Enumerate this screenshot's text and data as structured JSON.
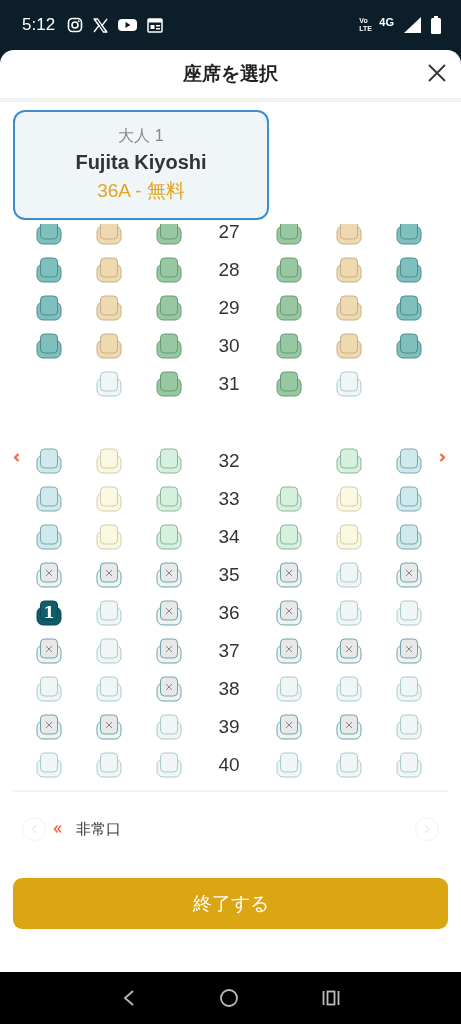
{
  "status_bar": {
    "time": "5:12",
    "volte": "Vo LTE",
    "network": "4G"
  },
  "header": {
    "title": "座席を選択"
  },
  "passengers": [
    {
      "label": "大人 1",
      "name": "Fujita Kiyoshi",
      "seat": "36A - 無料",
      "selected": true
    }
  ],
  "seat_rows": [
    {
      "label": "27",
      "exit": false,
      "seats": [
        {
          "kind": "teal"
        },
        {
          "kind": "tan"
        },
        {
          "kind": "green"
        },
        {
          "kind": "green"
        },
        {
          "kind": "tan"
        },
        {
          "kind": "teal"
        }
      ]
    },
    {
      "label": "28",
      "exit": false,
      "seats": [
        {
          "kind": "teal"
        },
        {
          "kind": "tan"
        },
        {
          "kind": "green"
        },
        {
          "kind": "green"
        },
        {
          "kind": "tan"
        },
        {
          "kind": "teal"
        }
      ]
    },
    {
      "label": "29",
      "exit": false,
      "seats": [
        {
          "kind": "teal"
        },
        {
          "kind": "tan"
        },
        {
          "kind": "green"
        },
        {
          "kind": "green"
        },
        {
          "kind": "tan"
        },
        {
          "kind": "teal"
        }
      ]
    },
    {
      "label": "30",
      "exit": false,
      "seats": [
        {
          "kind": "teal"
        },
        {
          "kind": "tan"
        },
        {
          "kind": "green"
        },
        {
          "kind": "green"
        },
        {
          "kind": "tan"
        },
        {
          "kind": "teal"
        }
      ]
    },
    {
      "label": "31",
      "exit": false,
      "seats": [
        {
          "kind": "none"
        },
        {
          "kind": "free"
        },
        {
          "kind": "green"
        },
        {
          "kind": "green"
        },
        {
          "kind": "free"
        },
        {
          "kind": "none"
        }
      ]
    },
    {
      "label": "32",
      "exit": true,
      "seats": [
        {
          "kind": "lightblue"
        },
        {
          "kind": "cream"
        },
        {
          "kind": "lightgreen"
        },
        {
          "kind": "none"
        },
        {
          "kind": "lightgreen"
        },
        {
          "kind": "lightblue"
        }
      ]
    },
    {
      "label": "33",
      "exit": false,
      "seats": [
        {
          "kind": "lightblue"
        },
        {
          "kind": "cream"
        },
        {
          "kind": "lightgreen"
        },
        {
          "kind": "lightgreen"
        },
        {
          "kind": "cream"
        },
        {
          "kind": "lightblue"
        }
      ]
    },
    {
      "label": "34",
      "exit": false,
      "seats": [
        {
          "kind": "lightblue"
        },
        {
          "kind": "cream"
        },
        {
          "kind": "lightgreen"
        },
        {
          "kind": "lightgreen"
        },
        {
          "kind": "cream"
        },
        {
          "kind": "lightblue"
        }
      ]
    },
    {
      "label": "35",
      "exit": false,
      "seats": [
        {
          "kind": "taken"
        },
        {
          "kind": "taken"
        },
        {
          "kind": "taken"
        },
        {
          "kind": "taken"
        },
        {
          "kind": "free"
        },
        {
          "kind": "taken"
        }
      ]
    },
    {
      "label": "36",
      "exit": false,
      "seats": [
        {
          "kind": "selected",
          "text": "1"
        },
        {
          "kind": "free"
        },
        {
          "kind": "taken"
        },
        {
          "kind": "taken"
        },
        {
          "kind": "free"
        },
        {
          "kind": "free"
        }
      ]
    },
    {
      "label": "37",
      "exit": false,
      "seats": [
        {
          "kind": "taken"
        },
        {
          "kind": "free"
        },
        {
          "kind": "taken"
        },
        {
          "kind": "taken"
        },
        {
          "kind": "taken"
        },
        {
          "kind": "taken"
        }
      ]
    },
    {
      "label": "38",
      "exit": false,
      "seats": [
        {
          "kind": "free"
        },
        {
          "kind": "free"
        },
        {
          "kind": "taken"
        },
        {
          "kind": "free"
        },
        {
          "kind": "free"
        },
        {
          "kind": "free"
        }
      ]
    },
    {
      "label": "39",
      "exit": false,
      "seats": [
        {
          "kind": "taken"
        },
        {
          "kind": "taken"
        },
        {
          "kind": "free"
        },
        {
          "kind": "taken"
        },
        {
          "kind": "taken"
        },
        {
          "kind": "free"
        }
      ]
    },
    {
      "label": "40",
      "exit": false,
      "seats": [
        {
          "kind": "free"
        },
        {
          "kind": "free"
        },
        {
          "kind": "free"
        },
        {
          "kind": "free"
        },
        {
          "kind": "free"
        },
        {
          "kind": "free"
        }
      ]
    }
  ],
  "legend": {
    "label": "非常口"
  },
  "finish_button": "終了する"
}
